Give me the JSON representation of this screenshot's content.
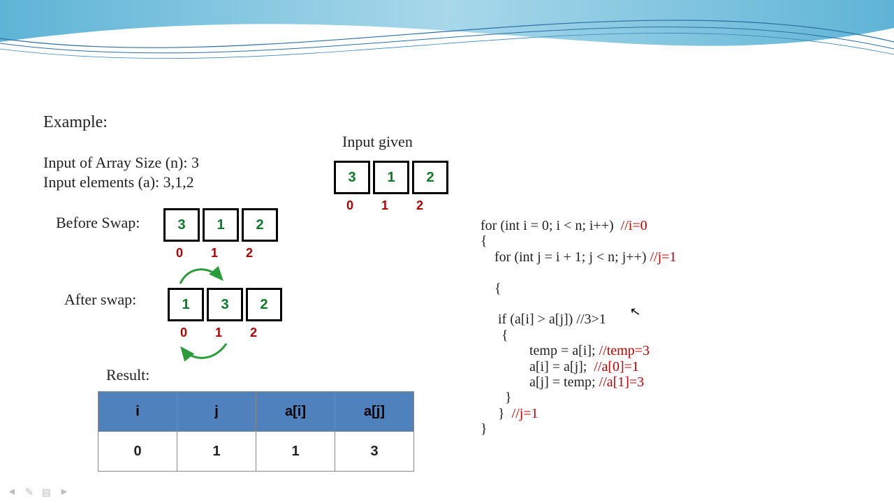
{
  "labels": {
    "example": "Example:",
    "array_size": "Input of Array Size (n): 3",
    "elements": "Input elements (a): 3,1,2",
    "input_given": "Input given",
    "before_swap": "Before Swap:",
    "after_swap": "After swap:",
    "result": "Result:"
  },
  "input_array": {
    "values": [
      "3",
      "1",
      "2"
    ],
    "indices": [
      "0",
      "1",
      "2"
    ]
  },
  "before_array": {
    "values": [
      "3",
      "1",
      "2"
    ],
    "indices": [
      "0",
      "1",
      "2"
    ]
  },
  "after_array": {
    "values": [
      "1",
      "3",
      "2"
    ],
    "indices": [
      "0",
      "1",
      "2"
    ]
  },
  "result_table": {
    "headers": [
      "i",
      "j",
      "a[i]",
      "a[j]"
    ],
    "row": [
      "0",
      "1",
      "1",
      "3"
    ]
  },
  "code": {
    "l1a": "for (int i = 0; i < n; i++)  ",
    "l1b": "//i=0",
    "l2": "{",
    "l3a": "    for (int j = i + 1; j < n; j++) ",
    "l3b": "//j=1",
    "l4": "",
    "l5": "    {",
    "l6": "",
    "l7": "     if (a[i] > a[j]) //3>1",
    "l8": "      {",
    "l9a": "              temp = a[i]; ",
    "l9b": "//temp=3",
    "l10a": "              a[i] = a[j];  ",
    "l10b": "//a[0]=1",
    "l11a": "              a[j] = temp; ",
    "l11b": "//a[1]=3",
    "l12": "       }",
    "l13a": "     }  ",
    "l13b": "//j=1",
    "l14": "}"
  }
}
